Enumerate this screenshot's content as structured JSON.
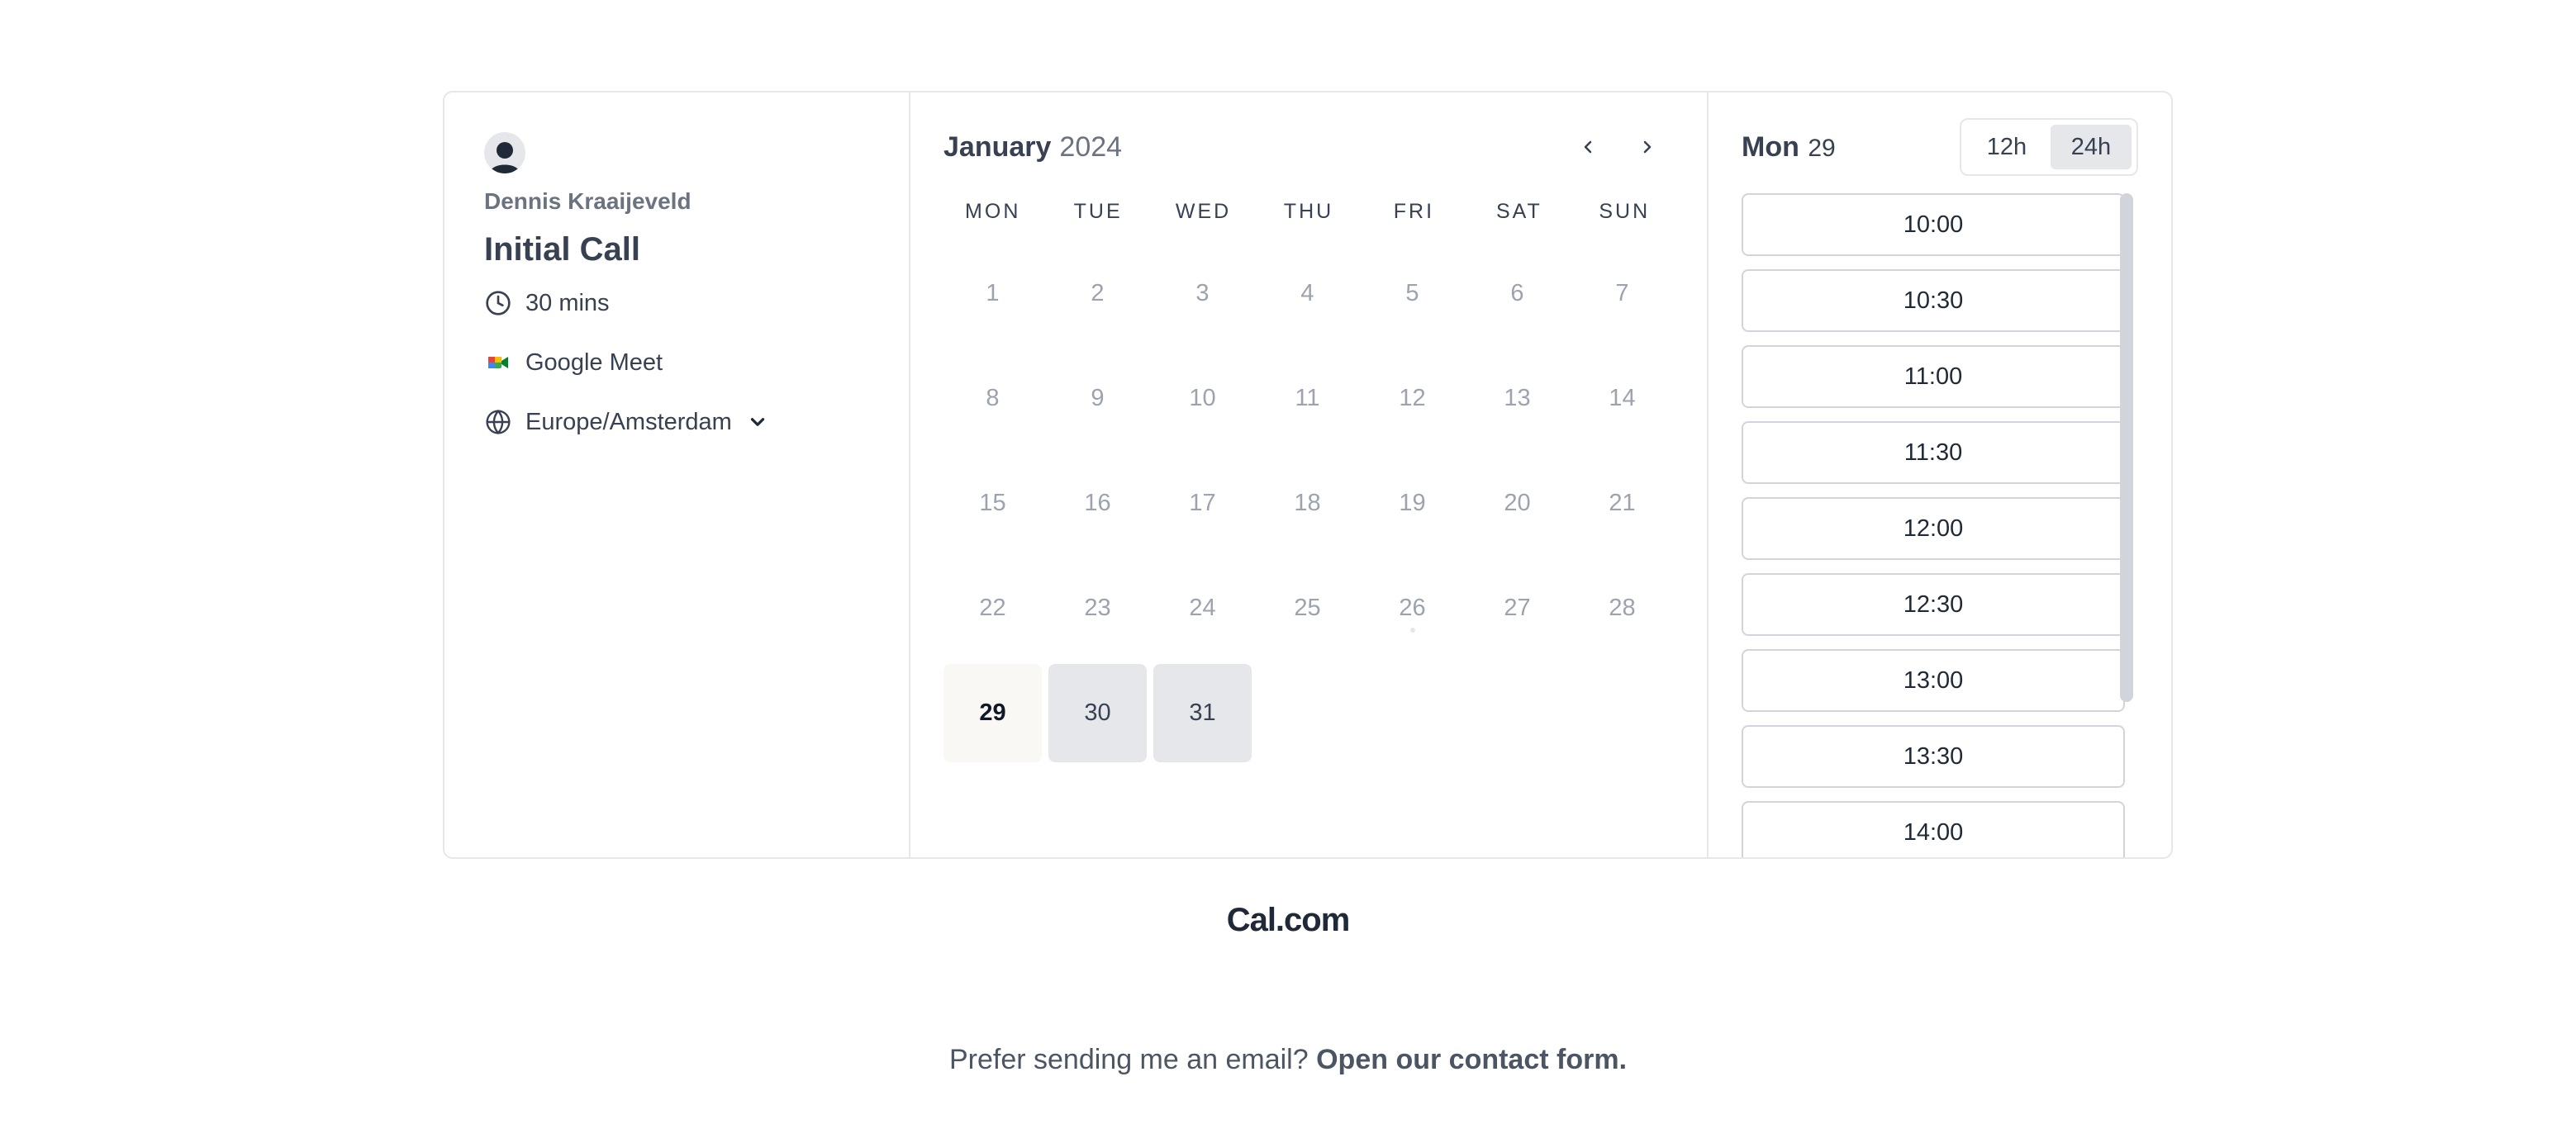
{
  "profile": {
    "organizer": "Dennis Kraaijeveld",
    "avatar_icon": "user-avatar-icon"
  },
  "event": {
    "title": "Initial Call",
    "duration": "30 mins",
    "location": "Google Meet",
    "timezone": "Europe/Amsterdam"
  },
  "calendar": {
    "month": "January",
    "year": "2024",
    "weekdays": [
      "MON",
      "TUE",
      "WED",
      "THU",
      "FRI",
      "SAT",
      "SUN"
    ],
    "days": [
      "1",
      "2",
      "3",
      "4",
      "5",
      "6",
      "7",
      "8",
      "9",
      "10",
      "11",
      "12",
      "13",
      "14",
      "15",
      "16",
      "17",
      "18",
      "19",
      "20",
      "21",
      "22",
      "23",
      "24",
      "25",
      "26",
      "27",
      "28",
      "29",
      "30",
      "31"
    ],
    "selected_day": "29",
    "available_days": [
      "29",
      "30",
      "31"
    ]
  },
  "slots": {
    "day_label": "Mon",
    "date_label": "29",
    "format_12h": "12h",
    "format_24h": "24h",
    "active_format": "24h",
    "times": [
      "10:00",
      "10:30",
      "11:00",
      "11:30",
      "12:00",
      "12:30",
      "13:00",
      "13:30",
      "14:00"
    ]
  },
  "brand": {
    "name": "Cal.com"
  },
  "footer": {
    "text": "Prefer sending me an email?",
    "link": "Open our contact form."
  },
  "colors": {
    "available_day_bg": "#e5e7eb",
    "selected_day_bg": "#f9f8f5",
    "border": "#e5e7eb"
  }
}
